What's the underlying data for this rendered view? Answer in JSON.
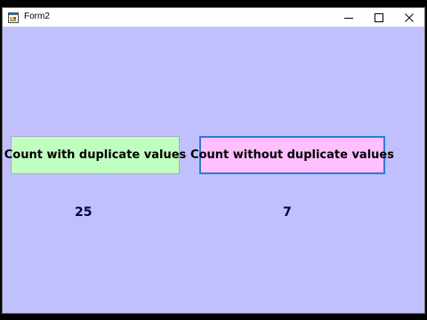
{
  "window": {
    "title": "Form2",
    "icon": "form-app-icon",
    "controls": {
      "minimize_icon": "minimize-icon",
      "maximize_icon": "maximize-icon",
      "close_icon": "close-icon"
    }
  },
  "form": {
    "background_color": "#c0c0ff",
    "buttons": {
      "with_duplicates": {
        "label": "Count with duplicate values",
        "background_color": "#c0ffc0"
      },
      "without_duplicates": {
        "label": "Count without duplicate values",
        "background_color": "#ffc0ff",
        "focused": true
      }
    },
    "results": {
      "with_duplicates_count": "25",
      "without_duplicates_count": "7"
    }
  }
}
